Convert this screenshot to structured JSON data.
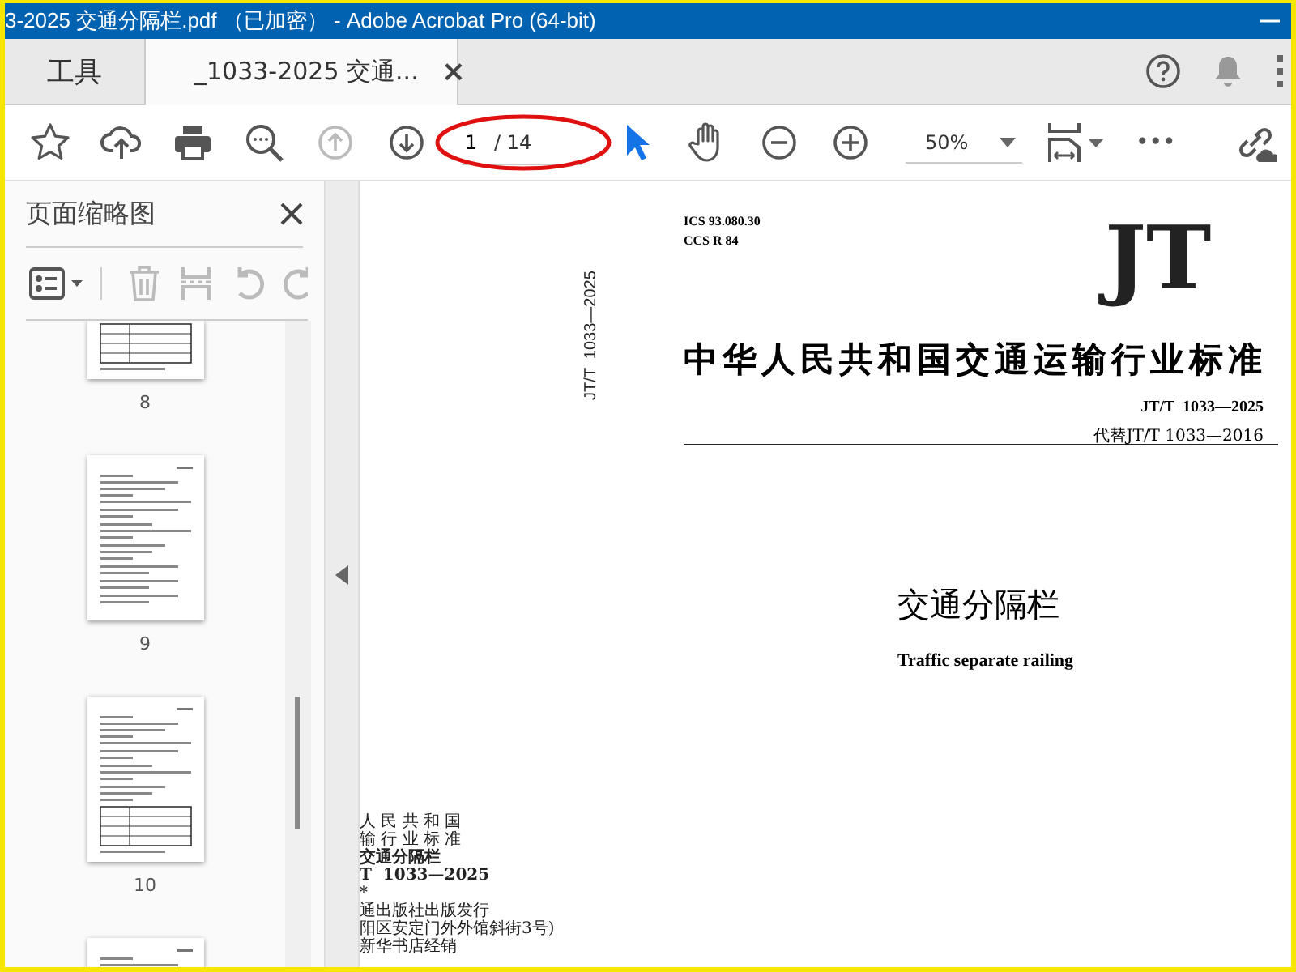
{
  "window": {
    "title": "3-2025 交通分隔栏.pdf （已加密） - Adobe Acrobat Pro (64-bit)"
  },
  "tabs": [
    {
      "label": "工具",
      "selected": false
    },
    {
      "label": "_1033-2025 交通...",
      "selected": true,
      "close": "×"
    }
  ],
  "toolbar": {
    "tools_left": [
      {
        "kind": "star",
        "disabled": false
      },
      {
        "kind": "upload",
        "disabled": false
      },
      {
        "kind": "print",
        "disabled": false
      },
      {
        "kind": "search",
        "disabled": false
      },
      {
        "kind": "prev",
        "disabled": true
      },
      {
        "kind": "next",
        "disabled": false
      }
    ],
    "page": {
      "value": "1",
      "total": "/ 14"
    },
    "tools_mid": [
      {
        "kind": "select",
        "selected": true
      },
      {
        "kind": "hand",
        "selected": false
      },
      {
        "kind": "zoom-out",
        "selected": false
      },
      {
        "kind": "zoom-in",
        "selected": false
      }
    ],
    "zoom": "50%",
    "more": "•••"
  },
  "sidebar": {
    "title": "页面缩略图",
    "tools": [
      {
        "kind": "options",
        "disabled": false
      },
      {
        "kind": "delete",
        "disabled": true
      },
      {
        "kind": "extract",
        "disabled": true
      },
      {
        "kind": "rotate-left",
        "disabled": true
      },
      {
        "kind": "rotate-right",
        "disabled": true
      }
    ],
    "thumbnails": [
      {
        "label": "8",
        "kind": "table",
        "cut_top": true
      },
      {
        "label": "9",
        "kind": "text",
        "cut_top": false
      },
      {
        "label": "10",
        "kind": "table",
        "cut_top": false
      },
      {
        "kind": "text",
        "cut_top": false
      }
    ]
  },
  "document": {
    "spine": "JT/T  1033—2025",
    "back_cover_lines": [
      {
        "text": "人 民 共 和 国",
        "bold": false
      },
      {
        "text": "输 行 业 标 准",
        "bold": false
      },
      {
        "text": "交通分隔栏",
        "bold": true
      },
      {
        "text": "T  1033—2025",
        "bold": true
      },
      {
        "text": "*",
        "bold": false
      },
      {
        "text": "通出版社出版发行",
        "bold": false
      },
      {
        "text": "阳区安定门外外馆斜街3号)",
        "bold": false
      },
      {
        "text": "新华书店经销",
        "bold": false
      }
    ],
    "cover": {
      "ics": "ICS 93.080.30",
      "ccs": "CCS R 84",
      "logo": "JT",
      "standard": "中华人民共和国交通运输行业标准",
      "number": "JT/T  1033—2025",
      "replaces": "代替JT/T 1033—2016",
      "title": "交通分隔栏",
      "title_en": "Traffic separate railing"
    }
  }
}
